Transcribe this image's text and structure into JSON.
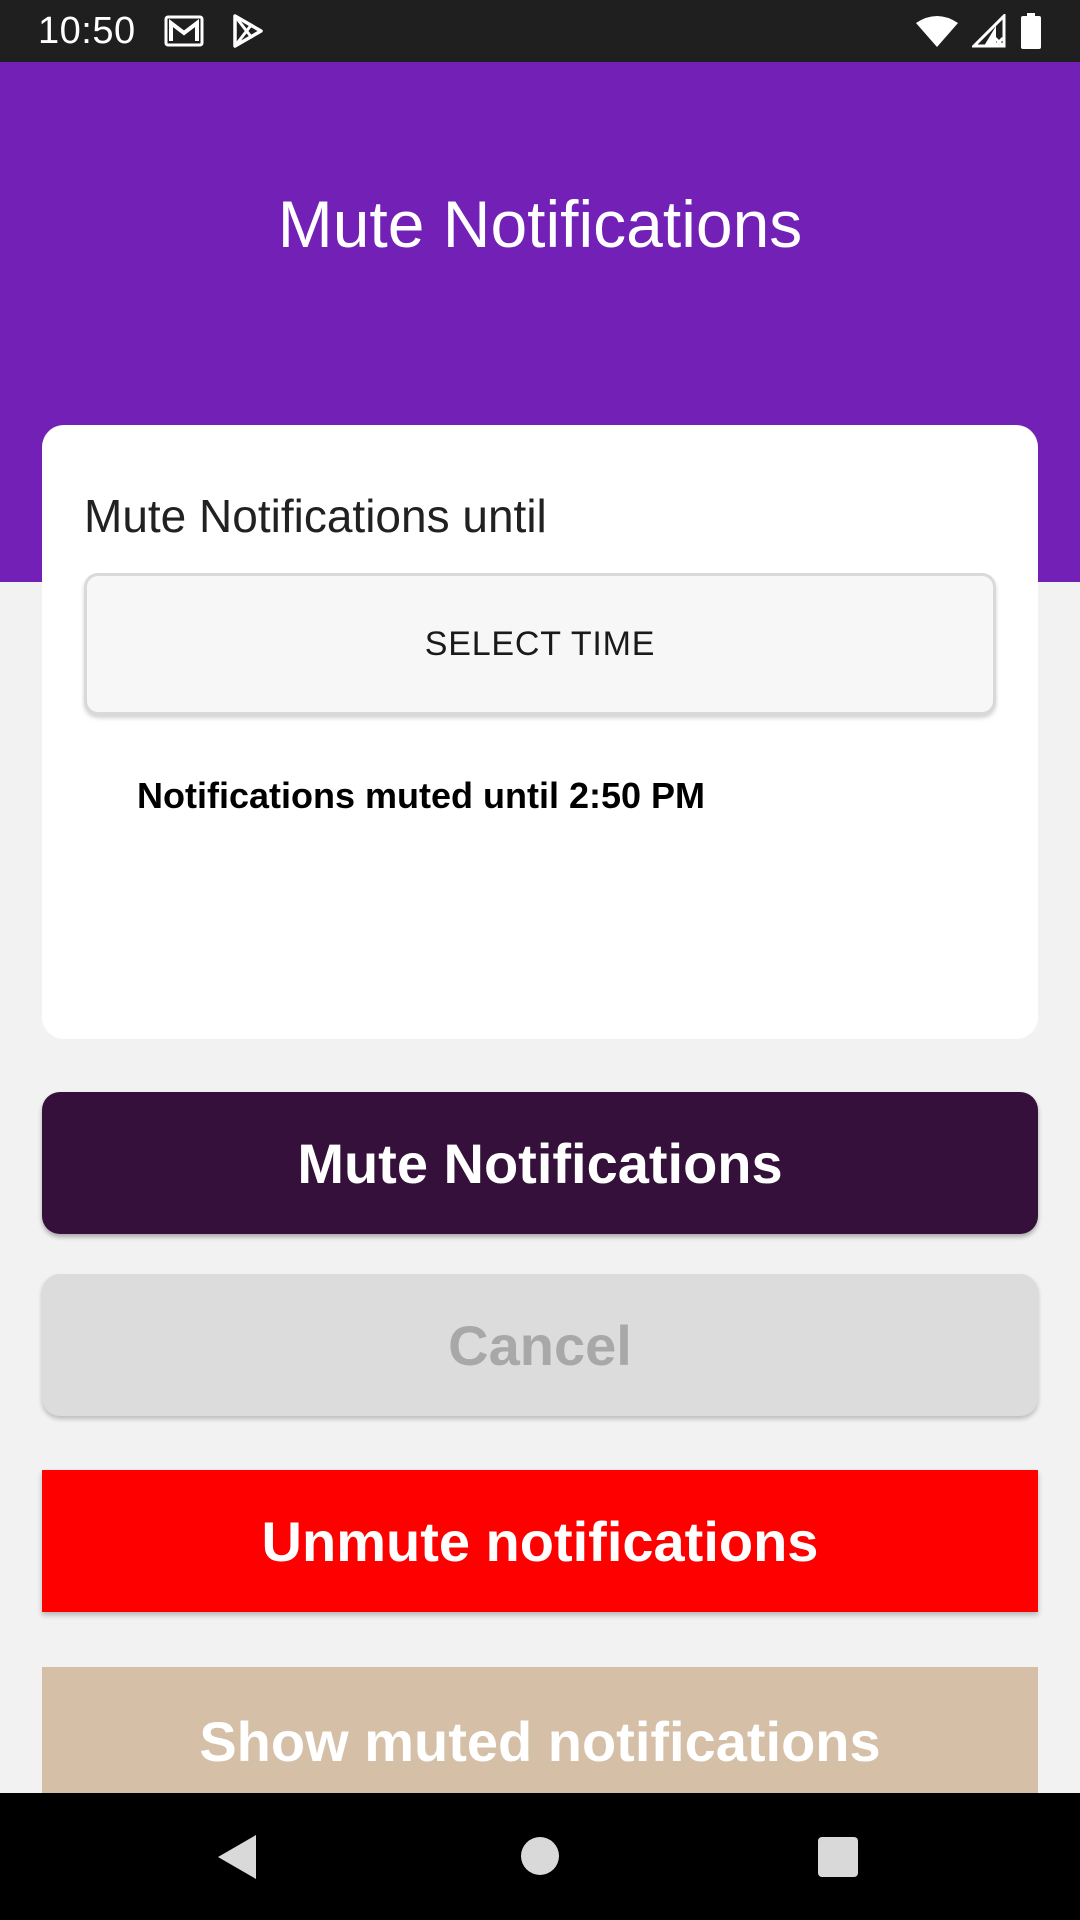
{
  "status_bar": {
    "time": "10:50",
    "icons": [
      "gmail-icon",
      "play-store-icon",
      "wifi-icon",
      "cell-signal-icon",
      "battery-icon"
    ]
  },
  "header": {
    "title": "Mute Notifications"
  },
  "card": {
    "label": "Mute Notifications until",
    "select_time_label": "SELECT TIME",
    "status_text": "Notifications muted until 2:50 PM"
  },
  "buttons": {
    "mute_label": "Mute Notifications",
    "cancel_label": "Cancel",
    "unmute_label": "Unmute notifications",
    "show_muted_label": "Show muted notifications"
  },
  "nav_bar": {
    "icons": [
      "back-icon",
      "home-icon",
      "recents-icon"
    ]
  },
  "colors": {
    "header": "#7220b5",
    "mute_button": "#35103a",
    "cancel_button": "#dcdcdc",
    "unmute_button": "#ff0000",
    "show_muted_button": "#d5bfa6"
  }
}
